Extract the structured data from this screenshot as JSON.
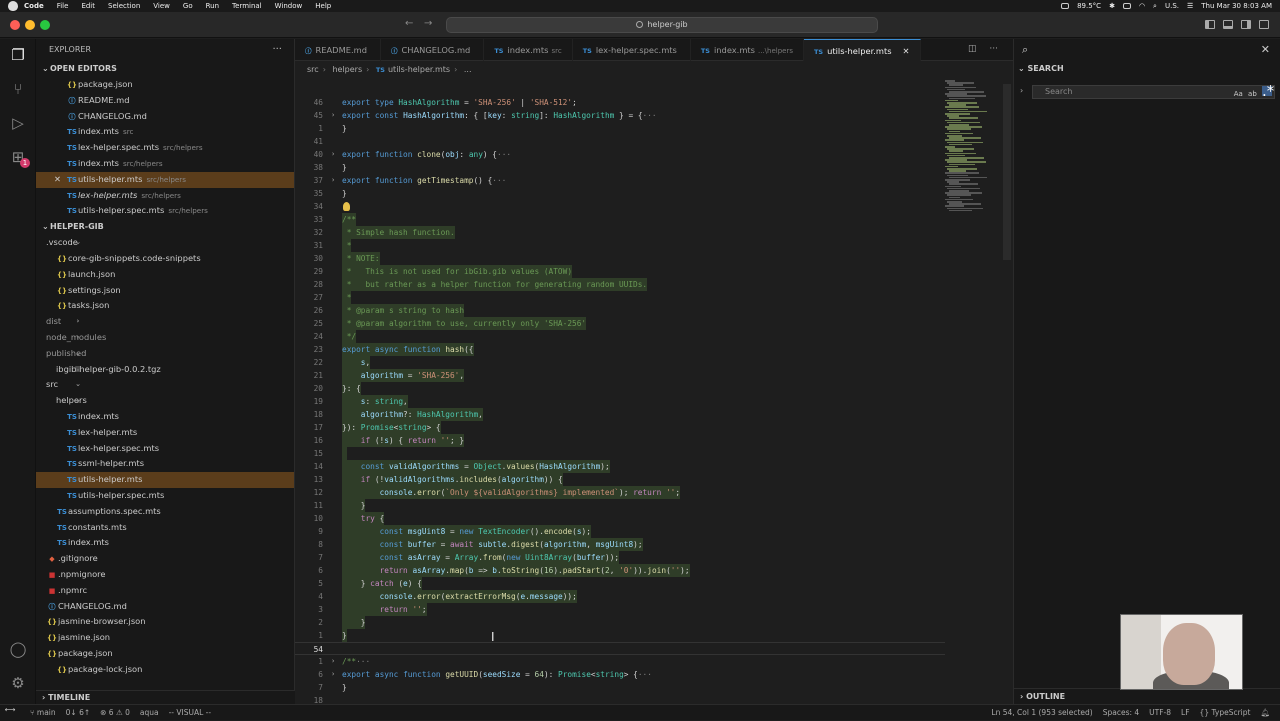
{
  "menubar": {
    "items": [
      "Code",
      "File",
      "Edit",
      "Selection",
      "View",
      "Go",
      "Run",
      "Terminal",
      "Window",
      "Help"
    ],
    "temp": "89.5°C",
    "locale": "U.S.",
    "clock": "Thu Mar 30  8:03 AM"
  },
  "titlebar": {
    "command_center": "helper-gib"
  },
  "explorer": {
    "title": "EXPLORER",
    "open_editors_label": "OPEN EDITORS",
    "open_editors": [
      {
        "icon": "{}",
        "kind": "json",
        "label": "package.json",
        "desc": ""
      },
      {
        "icon": "ⓘ",
        "kind": "md",
        "label": "README.md",
        "desc": ""
      },
      {
        "icon": "ⓘ",
        "kind": "md",
        "label": "CHANGELOG.md",
        "desc": ""
      },
      {
        "icon": "TS",
        "kind": "ts",
        "label": "index.mts",
        "desc": "src"
      },
      {
        "icon": "TS",
        "kind": "ts",
        "label": "lex-helper.spec.mts",
        "desc": "src/helpers"
      },
      {
        "icon": "TS",
        "kind": "ts",
        "label": "index.mts",
        "desc": "src/helpers"
      },
      {
        "icon": "TS",
        "kind": "ts",
        "label": "utils-helper.mts",
        "desc": "src/helpers"
      },
      {
        "icon": "TS",
        "kind": "ts",
        "label": "lex-helper.mts",
        "desc": "src/helpers"
      },
      {
        "icon": "TS",
        "kind": "ts",
        "label": "utils-helper.spec.mts",
        "desc": "src/helpers"
      }
    ],
    "workspace_label": "HELPER-GIB",
    "tree": [
      {
        "indent": 0,
        "chev": "⌄",
        "icon": "",
        "kind": "fold",
        "label": ".vscode"
      },
      {
        "indent": 1,
        "chev": "",
        "icon": "{}",
        "kind": "json",
        "label": "core-gib-snippets.code-snippets"
      },
      {
        "indent": 1,
        "chev": "",
        "icon": "{}",
        "kind": "json",
        "label": "launch.json"
      },
      {
        "indent": 1,
        "chev": "",
        "icon": "{}",
        "kind": "json",
        "label": "settings.json"
      },
      {
        "indent": 1,
        "chev": "",
        "icon": "{}",
        "kind": "json",
        "label": "tasks.json"
      },
      {
        "indent": 0,
        "chev": "›",
        "icon": "",
        "kind": "fold",
        "label": "dist"
      },
      {
        "indent": 0,
        "chev": "›",
        "icon": "",
        "kind": "fold",
        "label": "node_modules"
      },
      {
        "indent": 0,
        "chev": "⌄",
        "icon": "",
        "kind": "fold",
        "label": "published"
      },
      {
        "indent": 1,
        "chev": "",
        "icon": "▤",
        "kind": "fold",
        "label": "ibgib-helper-gib-0.0.2.tgz"
      },
      {
        "indent": 0,
        "chev": "⌄",
        "icon": "",
        "kind": "fold",
        "label": "src"
      },
      {
        "indent": 1,
        "chev": "⌄",
        "icon": "",
        "kind": "fold",
        "label": "helpers"
      },
      {
        "indent": 2,
        "chev": "",
        "icon": "TS",
        "kind": "ts",
        "label": "index.mts"
      },
      {
        "indent": 2,
        "chev": "",
        "icon": "TS",
        "kind": "ts",
        "label": "lex-helper.mts"
      },
      {
        "indent": 2,
        "chev": "",
        "icon": "TS",
        "kind": "ts",
        "label": "lex-helper.spec.mts"
      },
      {
        "indent": 2,
        "chev": "",
        "icon": "TS",
        "kind": "ts",
        "label": "ssml-helper.mts"
      },
      {
        "indent": 2,
        "chev": "",
        "icon": "TS",
        "kind": "ts",
        "label": "utils-helper.mts"
      },
      {
        "indent": 2,
        "chev": "",
        "icon": "TS",
        "kind": "ts",
        "label": "utils-helper.spec.mts"
      },
      {
        "indent": 1,
        "chev": "",
        "icon": "TS",
        "kind": "ts",
        "label": "assumptions.spec.mts"
      },
      {
        "indent": 1,
        "chev": "",
        "icon": "TS",
        "kind": "ts",
        "label": "constants.mts"
      },
      {
        "indent": 1,
        "chev": "",
        "icon": "TS",
        "kind": "ts",
        "label": "index.mts"
      },
      {
        "indent": 0,
        "chev": "",
        "icon": "◆",
        "kind": "git",
        "label": ".gitignore"
      },
      {
        "indent": 0,
        "chev": "",
        "icon": "■",
        "kind": "npm",
        "label": ".npmignore"
      },
      {
        "indent": 0,
        "chev": "",
        "icon": "■",
        "kind": "npm",
        "label": ".npmrc"
      },
      {
        "indent": 0,
        "chev": "",
        "icon": "ⓘ",
        "kind": "md",
        "label": "CHANGELOG.md"
      },
      {
        "indent": 0,
        "chev": "",
        "icon": "{}",
        "kind": "json",
        "label": "jasmine-browser.json"
      },
      {
        "indent": 0,
        "chev": "",
        "icon": "{}",
        "kind": "json",
        "label": "jasmine.json"
      },
      {
        "indent": 0,
        "chev": "⌄",
        "icon": "{}",
        "kind": "json",
        "label": "package.json"
      },
      {
        "indent": 1,
        "chev": "",
        "icon": "{}",
        "kind": "json",
        "label": "package-lock.json"
      }
    ],
    "timeline_label": "TIMELINE"
  },
  "tabs": [
    {
      "icon": "ⓘ",
      "kind": "md",
      "label": "README.md",
      "desc": ""
    },
    {
      "icon": "ⓘ",
      "kind": "md",
      "label": "CHANGELOG.md",
      "desc": ""
    },
    {
      "icon": "TS",
      "kind": "ts",
      "label": "index.mts",
      "desc": "src"
    },
    {
      "icon": "TS",
      "kind": "ts",
      "label": "lex-helper.spec.mts",
      "desc": ""
    },
    {
      "icon": "TS",
      "kind": "ts",
      "label": "index.mts",
      "desc": "...\\helpers"
    },
    {
      "icon": "TS",
      "kind": "ts",
      "label": "utils-helper.mts",
      "desc": ""
    }
  ],
  "breadcrumb": [
    "src",
    "helpers",
    "utils-helper.mts",
    "..."
  ],
  "editor": {
    "lines": [
      {
        "n": "46",
        "fold": "",
        "sel": false,
        "html": "<span class='kw'>export</span> <span class='kw'>type</span> <span class='ty'>HashAlgorithm</span> = <span class='st'>'SHA-256'</span> | <span class='st'>'SHA-512'</span>;"
      },
      {
        "n": "45",
        "fold": "›",
        "sel": false,
        "html": "<span class='kw'>export</span> <span class='kw'>const</span> <span class='vr'>HashAlgorithm</span>: { [<span class='vr'>key</span>: <span class='ty'>string</span>]: <span class='ty'>HashAlgorithm</span> } = {<span class='ph'>···</span>"
      },
      {
        "n": "1",
        "fold": "",
        "sel": false,
        "html": "}"
      },
      {
        "n": "41",
        "fold": "",
        "sel": false,
        "html": ""
      },
      {
        "n": "40",
        "fold": "›",
        "sel": false,
        "html": "<span class='kw'>export</span> <span class='kw'>function</span> <span class='fn'>clone</span>(<span class='vr'>obj</span>: <span class='ty'>any</span>) {<span class='ph'>···</span>"
      },
      {
        "n": "38",
        "fold": "",
        "sel": false,
        "html": "}"
      },
      {
        "n": "37",
        "fold": "›",
        "sel": false,
        "html": "<span class='kw'>export</span> <span class='kw'>function</span> <span class='fn'>getTimestamp</span>() {<span class='ph'>···</span>"
      },
      {
        "n": "35",
        "fold": "",
        "sel": false,
        "html": "}"
      },
      {
        "n": "34",
        "fold": "",
        "sel": false,
        "html": ""
      },
      {
        "n": "33",
        "fold": "",
        "sel": true,
        "html": "<span class='cm'>/**</span>"
      },
      {
        "n": "32",
        "fold": "",
        "sel": true,
        "html": "<span class='cm'> * Simple hash function.</span>"
      },
      {
        "n": "31",
        "fold": "",
        "sel": true,
        "html": "<span class='cm'> *</span>"
      },
      {
        "n": "30",
        "fold": "",
        "sel": true,
        "html": "<span class='cm'> * NOTE:</span>"
      },
      {
        "n": "29",
        "fold": "",
        "sel": true,
        "html": "<span class='cm'> *   This is not used for ibGib.gib values (ATOW)</span>"
      },
      {
        "n": "28",
        "fold": "",
        "sel": true,
        "html": "<span class='cm'> *   but rather as a helper function for generating random UUIDs.</span>"
      },
      {
        "n": "27",
        "fold": "",
        "sel": true,
        "html": "<span class='cm'> *</span>"
      },
      {
        "n": "26",
        "fold": "",
        "sel": true,
        "html": "<span class='cm'> * @param s string to hash</span>"
      },
      {
        "n": "25",
        "fold": "",
        "sel": true,
        "html": "<span class='cm'> * @param algorithm to use, currently only 'SHA-256'</span>"
      },
      {
        "n": "24",
        "fold": "",
        "sel": true,
        "html": "<span class='cm'> */</span>"
      },
      {
        "n": "23",
        "fold": "",
        "sel": true,
        "html": "<span class='kw'>export</span> <span class='kw'>async</span> <span class='kw'>function</span> <span class='fn'>hash</span>({"
      },
      {
        "n": "22",
        "fold": "",
        "sel": true,
        "html": "    <span class='vr'>s</span>,"
      },
      {
        "n": "21",
        "fold": "",
        "sel": true,
        "html": "    <span class='vr'>algorithm</span> = <span class='st'>'SHA-256'</span>,"
      },
      {
        "n": "20",
        "fold": "",
        "sel": true,
        "html": "}: {"
      },
      {
        "n": "19",
        "fold": "",
        "sel": true,
        "html": "    <span class='vr'>s</span>: <span class='ty'>string</span>,"
      },
      {
        "n": "18",
        "fold": "",
        "sel": true,
        "html": "    <span class='vr'>algorithm</span>?: <span class='ty'>HashAlgorithm</span>,"
      },
      {
        "n": "17",
        "fold": "",
        "sel": true,
        "html": "}): <span class='ty'>Promise</span>&lt;<span class='ty'>string</span>&gt; {"
      },
      {
        "n": "16",
        "fold": "",
        "sel": true,
        "html": "    <span class='kw2'>if</span> (!<span class='vr'>s</span>) { <span class='kw2'>return</span> <span class='st'>''</span>; }"
      },
      {
        "n": "15",
        "fold": "",
        "sel": true,
        "html": ""
      },
      {
        "n": "14",
        "fold": "",
        "sel": true,
        "html": "    <span class='kw'>const</span> <span class='vr'>validAlgorithms</span> = <span class='ty'>Object</span>.<span class='fn'>values</span>(<span class='vr'>HashAlgorithm</span>);"
      },
      {
        "n": "13",
        "fold": "",
        "sel": true,
        "html": "    <span class='kw2'>if</span> (!<span class='vr'>validAlgorithms</span>.<span class='fn'>includes</span>(<span class='vr'>algorithm</span>)) {"
      },
      {
        "n": "12",
        "fold": "",
        "sel": true,
        "html": "        <span class='vr'>console</span>.<span class='fn'>error</span>(<span class='st'>`Only ${validAlgorithms} implemented`</span>); <span class='kw2'>return</span> <span class='st'>''</span>;"
      },
      {
        "n": "11",
        "fold": "",
        "sel": true,
        "html": "    }"
      },
      {
        "n": "10",
        "fold": "",
        "sel": true,
        "html": "    <span class='kw2'>try</span> {"
      },
      {
        "n": "9",
        "fold": "",
        "sel": true,
        "html": "        <span class='kw'>const</span> <span class='vr'>msgUint8</span> = <span class='kw'>new</span> <span class='ty'>TextEncoder</span>().<span class='fn'>encode</span>(<span class='vr'>s</span>);"
      },
      {
        "n": "8",
        "fold": "",
        "sel": true,
        "html": "        <span class='kw'>const</span> <span class='vr'>buffer</span> = <span class='kw2'>await</span> <span class='vr'>subtle</span>.<span class='fn'>digest</span>(<span class='vr'>algorithm</span>, <span class='vr'>msgUint8</span>);"
      },
      {
        "n": "7",
        "fold": "",
        "sel": true,
        "html": "        <span class='kw'>const</span> <span class='vr'>asArray</span> = <span class='ty'>Array</span>.<span class='fn'>from</span>(<span class='kw'>new</span> <span class='ty'>Uint8Array</span>(<span class='vr'>buffer</span>));"
      },
      {
        "n": "6",
        "fold": "",
        "sel": true,
        "html": "        <span class='kw2'>return</span> <span class='vr'>asArray</span>.<span class='fn'>map</span>(<span class='vr'>b</span> =&gt; <span class='vr'>b</span>.<span class='fn'>toString</span>(<span class='nm'>16</span>).<span class='fn'>padStart</span>(<span class='nm'>2</span>, <span class='st'>'0'</span>)).<span class='fn'>join</span>(<span class='st'>''</span>);"
      },
      {
        "n": "5",
        "fold": "",
        "sel": true,
        "html": "    } <span class='kw2'>catch</span> (<span class='vr'>e</span>) {"
      },
      {
        "n": "4",
        "fold": "",
        "sel": true,
        "html": "        <span class='vr'>console</span>.<span class='fn'>error</span>(<span class='fn'>extractErrorMsg</span>(<span class='vr'>e</span>.<span class='vr'>message</span>));"
      },
      {
        "n": "3",
        "fold": "",
        "sel": true,
        "html": "        <span class='kw2'>return</span> <span class='st'>''</span>;"
      },
      {
        "n": "2",
        "fold": "",
        "sel": true,
        "html": "    }"
      },
      {
        "n": "1",
        "fold": "",
        "sel": true,
        "html": "}"
      },
      {
        "n": "54",
        "fold": "",
        "sel": false,
        "cur": true,
        "html": ""
      },
      {
        "n": "1",
        "fold": "›",
        "sel": false,
        "html": "<span class='cm'>/**</span><span class='ph'>···</span>"
      },
      {
        "n": "6",
        "fold": "›",
        "sel": false,
        "html": "<span class='kw'>export</span> <span class='kw'>async</span> <span class='kw'>function</span> <span class='fn'>getUUID</span>(<span class='vr'>seedSize</span> = <span class='nm'>64</span>): <span class='ty'>Promise</span>&lt;<span class='ty'>string</span>&gt; {<span class='ph'>···</span>"
      },
      {
        "n": "7",
        "fold": "",
        "sel": false,
        "html": "}"
      },
      {
        "n": "18",
        "fold": "",
        "sel": false,
        "html": ""
      }
    ]
  },
  "search_panel": {
    "header": "SEARCH",
    "placeholder": "Search",
    "match_case": "Aa",
    "whole_word": "ab",
    "regex": ".*",
    "outline": "OUTLINE"
  },
  "statusbar": {
    "branch": "main",
    "sync": "0↓ 6↑",
    "problems": "⊗ 6  ⚠ 0",
    "theme": "aqua",
    "mode": "-- VISUAL --",
    "position": "Ln 54, Col 1 (953 selected)",
    "spaces": "Spaces: 4",
    "encoding": "UTF-8",
    "eol": "LF",
    "language": "{} TypeScript"
  }
}
